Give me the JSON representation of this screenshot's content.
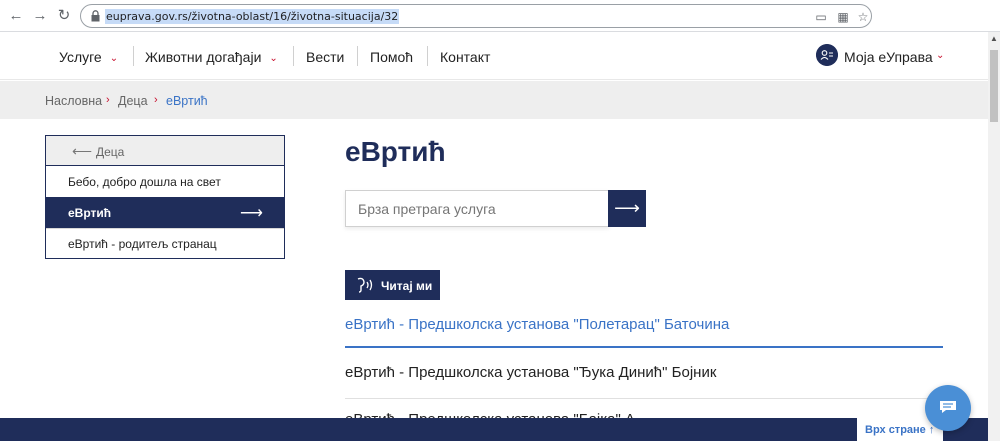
{
  "browser": {
    "url": "euprava.gov.rs/životna-oblast/16/životna-situacija/32",
    "back_icon": "←",
    "forward_icon": "→",
    "reload_icon": "↻",
    "star_icon": "☆"
  },
  "nav": {
    "items": [
      {
        "label": "Услуге"
      },
      {
        "label": "Животни догађаји"
      },
      {
        "label": "Вести"
      },
      {
        "label": "Помоћ"
      },
      {
        "label": "Контакт"
      }
    ],
    "account_label": "Моја еУправа",
    "chevron": "⌄"
  },
  "breadcrumb": {
    "items": [
      "Насловна",
      "Деца",
      "еВртић"
    ],
    "separator": "›"
  },
  "sidebar": {
    "back_label": "Деца",
    "items": [
      {
        "label": "Бебо, добро дошла на свет"
      },
      {
        "label": "еВртић"
      },
      {
        "label": "еВртић - родитељ странац"
      }
    ]
  },
  "main": {
    "title": "еВртић",
    "search_placeholder": "Брза претрага услуга",
    "read_label": "Читај ми",
    "results": [
      "еВртић - Предшколска установа \"Полетарац\" Баточина",
      "еВртић - Предшколска установа \"Ђука Динић\" Бојник",
      "еВртић - Предшколска установа \"Бајка\" А..."
    ]
  },
  "footer": {
    "to_top_label": "Врх стране ↑"
  },
  "colors": {
    "primary": "#1f2d5a",
    "accent": "#c8102e",
    "link": "#3a73c6"
  }
}
